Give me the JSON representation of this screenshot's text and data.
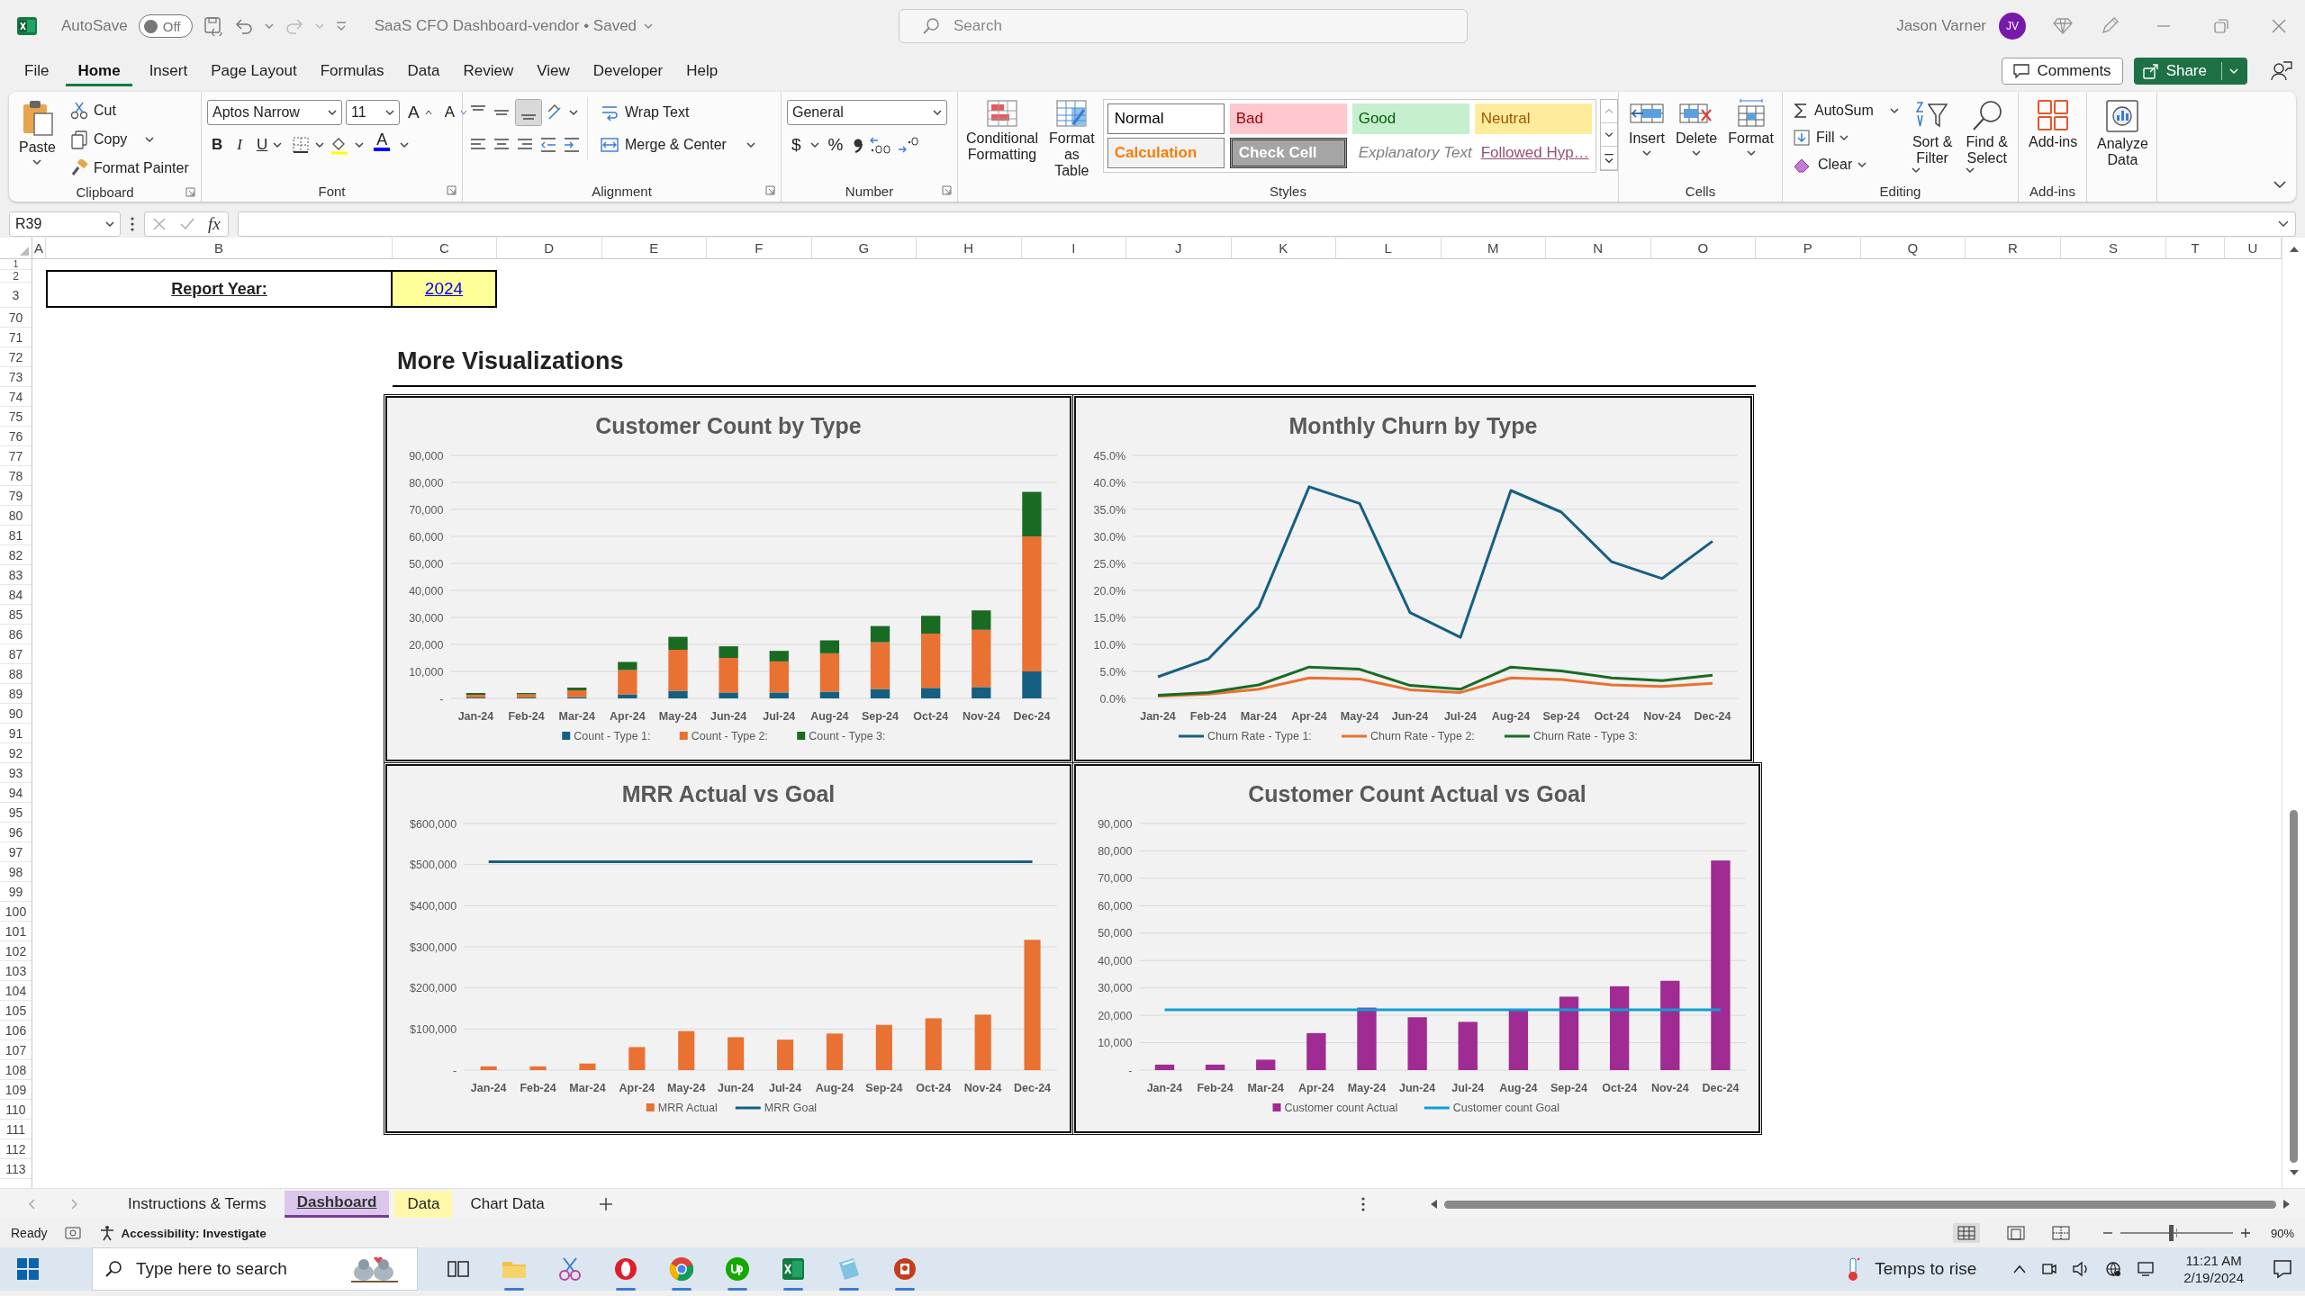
{
  "title_bar": {
    "autosave": {
      "label": "AutoSave",
      "state_label": "Off",
      "on": false
    },
    "document_title": "SaaS CFO Dashboard-vendor • Saved",
    "search_placeholder": "Search",
    "user_name": "Jason Varner",
    "user_initials": "JV"
  },
  "menu_tabs": [
    {
      "label": "File",
      "selected": false
    },
    {
      "label": "Home",
      "selected": true
    },
    {
      "label": "Insert",
      "selected": false
    },
    {
      "label": "Page Layout",
      "selected": false
    },
    {
      "label": "Formulas",
      "selected": false
    },
    {
      "label": "Data",
      "selected": false
    },
    {
      "label": "Review",
      "selected": false
    },
    {
      "label": "View",
      "selected": false
    },
    {
      "label": "Developer",
      "selected": false
    },
    {
      "label": "Help",
      "selected": false
    }
  ],
  "header_buttons": {
    "comments": "Comments",
    "share": "Share"
  },
  "ribbon": {
    "clipboard": {
      "label": "Clipboard",
      "paste": "Paste",
      "cut": "Cut",
      "copy": "Copy",
      "format_painter": "Format Painter"
    },
    "font": {
      "label": "Font",
      "font_name": "Aptos Narrow",
      "font_size": "11",
      "grow": "A",
      "shrink": "A",
      "bold": "B",
      "italic": "I",
      "underline": "U",
      "font_color": "A"
    },
    "alignment": {
      "label": "Alignment",
      "wrap_text": "Wrap Text",
      "merge_center": "Merge & Center"
    },
    "number": {
      "label": "Number",
      "format": "General",
      "currency": "$",
      "percent": "%"
    },
    "conditional_formatting": "Conditional Formatting",
    "format_as_table": "Format as Table",
    "styles": {
      "label": "Styles",
      "items": [
        {
          "label": "Normal",
          "kind": "normal"
        },
        {
          "label": "Bad",
          "kind": "bad"
        },
        {
          "label": "Good",
          "kind": "good"
        },
        {
          "label": "Neutral",
          "kind": "neutral"
        },
        {
          "label": "Calculation",
          "kind": "calculation"
        },
        {
          "label": "Check Cell",
          "kind": "check"
        },
        {
          "label": "Explanatory Text",
          "kind": "explanatory"
        },
        {
          "label": "Followed Hyp…",
          "kind": "followed"
        }
      ]
    },
    "cells": {
      "label": "Cells",
      "insert": "Insert",
      "delete": "Delete",
      "format": "Format"
    },
    "editing": {
      "label": "Editing",
      "autosum": "AutoSum",
      "fill": "Fill",
      "clear": "Clear",
      "sort_filter": "Sort & Filter",
      "find_select": "Find & Select"
    },
    "add_ins": {
      "label": "Add-ins",
      "button": "Add-ins"
    },
    "analyze_data": "Analyze Data"
  },
  "formula_bar": {
    "name_box": "R39",
    "function_label": "fx"
  },
  "columns": [
    "A",
    "B",
    "C",
    "D",
    "E",
    "F",
    "G",
    "H",
    "I",
    "J",
    "K",
    "L",
    "M",
    "N",
    "O",
    "P",
    "Q",
    "R",
    "S",
    "T",
    "U"
  ],
  "rows": [
    "1",
    "2",
    "3",
    "70",
    "71",
    "72",
    "73",
    "74",
    "75",
    "76",
    "77",
    "78",
    "79",
    "80",
    "81",
    "82",
    "83",
    "84",
    "85",
    "86",
    "87",
    "88",
    "89",
    "90",
    "91",
    "92",
    "93",
    "94",
    "95",
    "96",
    "97",
    "98",
    "99",
    "100",
    "101",
    "102",
    "103",
    "104",
    "105",
    "106",
    "107",
    "108",
    "109",
    "110",
    "111",
    "112",
    "113"
  ],
  "sheet": {
    "report_year_label": "Report Year:",
    "report_year_value": "2024",
    "section_heading": "More Visualizations",
    "charts": [
      {
        "chart_data": {
          "type": "bar",
          "title": "Customer Count by Type",
          "grid": true,
          "legend": true,
          "stacked": true,
          "categories": [
            "Jan-24",
            "Feb-24",
            "Mar-24",
            "Apr-24",
            "May-24",
            "Jun-24",
            "Jul-24",
            "Aug-24",
            "Sep-24",
            "Oct-24",
            "Nov-24",
            "Dec-24"
          ],
          "ylim": [
            0,
            90000
          ],
          "yticks": [
            {
              "value": 0,
              "label": "-"
            },
            {
              "value": 10000,
              "label": "10,000"
            },
            {
              "value": 20000,
              "label": "20,000"
            },
            {
              "value": 30000,
              "label": "30,000"
            },
            {
              "value": 40000,
              "label": "40,000"
            },
            {
              "value": 50000,
              "label": "50,000"
            },
            {
              "value": 60000,
              "label": "60,000"
            },
            {
              "value": 70000,
              "label": "70,000"
            },
            {
              "value": 80000,
              "label": "80,000"
            },
            {
              "value": 90000,
              "label": "90,000"
            }
          ],
          "series": [
            {
              "name": "Count - Type 1:",
              "color": "#156082",
              "values": [
                300,
                300,
                500,
                1500,
                2800,
                2200,
                2200,
                2500,
                3500,
                3900,
                4200,
                10000
              ]
            },
            {
              "name": "Count - Type 2:",
              "color": "#e97132",
              "values": [
                1000,
                1200,
                2500,
                9000,
                15200,
                12800,
                11500,
                14200,
                17300,
                20100,
                21200,
                50000
              ]
            },
            {
              "name": "Count - Type 3:",
              "color": "#196b24",
              "values": [
                700,
                500,
                1000,
                3000,
                4800,
                4300,
                3900,
                4800,
                6000,
                6600,
                7200,
                16500
              ]
            }
          ]
        }
      },
      {
        "chart_data": {
          "type": "line",
          "title": "Monthly Churn by Type",
          "grid": true,
          "legend": true,
          "categories": [
            "Jan-24",
            "Feb-24",
            "Mar-24",
            "Apr-24",
            "May-24",
            "Jun-24",
            "Jul-24",
            "Aug-24",
            "Sep-24",
            "Oct-24",
            "Nov-24",
            "Dec-24"
          ],
          "ylim": [
            0,
            45
          ],
          "yticks": [
            {
              "value": 0,
              "label": "0.0%"
            },
            {
              "value": 5,
              "label": "5.0%"
            },
            {
              "value": 10,
              "label": "10.0%"
            },
            {
              "value": 15,
              "label": "15.0%"
            },
            {
              "value": 20,
              "label": "20.0%"
            },
            {
              "value": 25,
              "label": "25.0%"
            },
            {
              "value": 30,
              "label": "30.0%"
            },
            {
              "value": 35,
              "label": "35.0%"
            },
            {
              "value": 40,
              "label": "40.0%"
            },
            {
              "value": 45,
              "label": "45.0%"
            }
          ],
          "series": [
            {
              "name": "Churn Rate - Type 1:",
              "color": "#156082",
              "values": [
                4.0,
                7.3,
                16.9,
                39.2,
                36.1,
                15.9,
                11.3,
                38.5,
                34.5,
                25.3,
                22.2,
                29.1
              ]
            },
            {
              "name": "Churn Rate - Type 2:",
              "color": "#e97132",
              "values": [
                0.4,
                0.8,
                1.7,
                3.8,
                3.6,
                1.6,
                1.1,
                3.8,
                3.5,
                2.5,
                2.2,
                2.8
              ]
            },
            {
              "name": "Churn Rate - Type 3:",
              "color": "#196b24",
              "values": [
                0.6,
                1.1,
                2.5,
                5.8,
                5.4,
                2.4,
                1.7,
                5.8,
                5.1,
                3.8,
                3.3,
                4.3
              ]
            }
          ]
        }
      },
      {
        "chart_data": {
          "type": "bar",
          "title": "MRR Actual vs Goal",
          "grid": true,
          "legend": true,
          "categories": [
            "Jan-24",
            "Feb-24",
            "Mar-24",
            "Apr-24",
            "May-24",
            "Jun-24",
            "Jul-24",
            "Aug-24",
            "Sep-24",
            "Oct-24",
            "Nov-24",
            "Dec-24"
          ],
          "ylim": [
            0,
            600000
          ],
          "yticks": [
            {
              "value": 0,
              "label": "-"
            },
            {
              "value": 100000,
              "label": "$100,000"
            },
            {
              "value": 200000,
              "label": "$200,000"
            },
            {
              "value": 300000,
              "label": "$300,000"
            },
            {
              "value": 400000,
              "label": "$400,000"
            },
            {
              "value": 500000,
              "label": "$500,000"
            },
            {
              "value": 600000,
              "label": "$600,000"
            }
          ],
          "series": [
            {
              "name": "MRR Actual",
              "color": "#e97132",
              "type": "bar",
              "values": [
                9000,
                9000,
                16000,
                56000,
                95000,
                80000,
                74000,
                89000,
                110000,
                126000,
                135000,
                317000
              ]
            },
            {
              "name": "MRR Goal",
              "color": "#156082",
              "type": "line",
              "values": [
                507000,
                507000,
                507000,
                507000,
                507000,
                507000,
                507000,
                507000,
                507000,
                507000,
                507000,
                507000
              ]
            }
          ]
        }
      },
      {
        "chart_data": {
          "type": "bar",
          "title": "Customer Count Actual vs Goal",
          "grid": true,
          "legend": true,
          "categories": [
            "Jan-24",
            "Feb-24",
            "Mar-24",
            "Apr-24",
            "May-24",
            "Jun-24",
            "Jul-24",
            "Aug-24",
            "Sep-24",
            "Oct-24",
            "Nov-24",
            "Dec-24"
          ],
          "ylim": [
            0,
            90000
          ],
          "yticks": [
            {
              "value": 0,
              "label": "-"
            },
            {
              "value": 10000,
              "label": "10,000"
            },
            {
              "value": 20000,
              "label": "20,000"
            },
            {
              "value": 30000,
              "label": "30,000"
            },
            {
              "value": 40000,
              "label": "40,000"
            },
            {
              "value": 50000,
              "label": "50,000"
            },
            {
              "value": 60000,
              "label": "60,000"
            },
            {
              "value": 70000,
              "label": "70,000"
            },
            {
              "value": 80000,
              "label": "80,000"
            },
            {
              "value": 90000,
              "label": "90,000"
            }
          ],
          "series": [
            {
              "name": "Customer count Actual",
              "color": "#a02b93",
              "type": "bar",
              "values": [
                2000,
                2000,
                3800,
                13500,
                22800,
                19300,
                17600,
                21700,
                26800,
                30600,
                32600,
                76500
              ]
            },
            {
              "name": "Customer count Goal",
              "color": "#0f9ed5",
              "type": "line",
              "values": [
                22000,
                22000,
                22000,
                22000,
                22000,
                22000,
                22000,
                22000,
                22000,
                22000,
                22000,
                22000
              ]
            }
          ]
        }
      }
    ]
  },
  "sheet_tabs": [
    {
      "label": "Instructions & Terms",
      "selected": false
    },
    {
      "label": "Dashboard",
      "selected": true,
      "color": "#dcc6ec"
    },
    {
      "label": "Data",
      "selected": false,
      "color": "#fff8a8"
    },
    {
      "label": "Chart Data",
      "selected": false
    }
  ],
  "status_bar": {
    "status": "Ready",
    "accessibility": "Accessibility: Investigate",
    "zoom": {
      "level": 0.45,
      "label": "90%"
    }
  },
  "taskbar": {
    "search_placeholder": "Type here to search",
    "weather": "Temps to rise",
    "time": "11:21 AM",
    "date": "2/19/2024"
  }
}
